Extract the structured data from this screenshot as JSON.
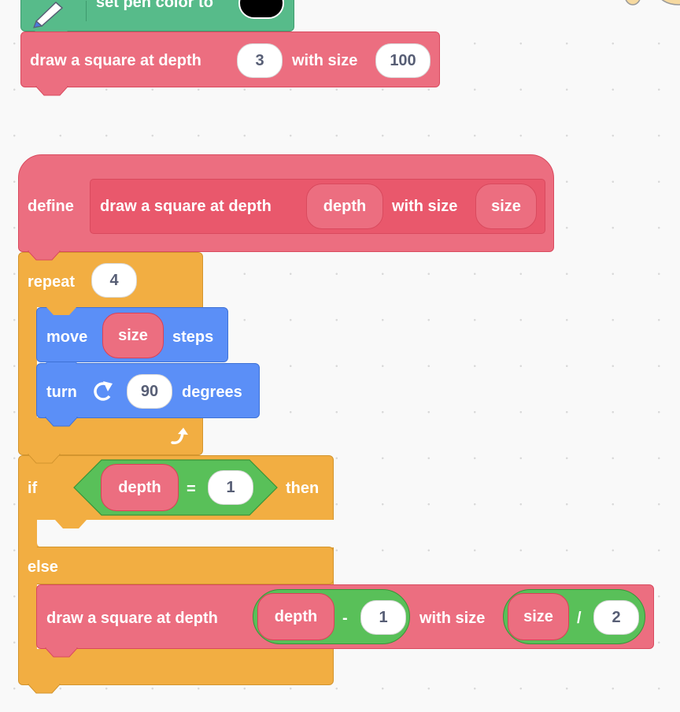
{
  "workspace": {
    "pen_block": {
      "label": "set pen color to",
      "color_value": "#000000",
      "icon": "pen-icon"
    },
    "call_block_top": {
      "label_1": "draw a square at depth",
      "depth_value": "3",
      "label_2": "with size",
      "size_value": "100"
    },
    "define_block": {
      "keyword": "define",
      "proto_label_1": "draw a square at depth",
      "param_1": "depth",
      "proto_label_2": "with size",
      "param_2": "size"
    },
    "repeat_block": {
      "keyword": "repeat",
      "count": "4",
      "loop_icon": "loop-arrow-icon"
    },
    "move_block": {
      "label_1": "move",
      "arg": "size",
      "label_2": "steps"
    },
    "turn_block": {
      "label_1": "turn",
      "icon": "rotate-right-icon",
      "value": "90",
      "label_2": "degrees"
    },
    "if_block": {
      "keyword_if": "if",
      "cond_left": "depth",
      "operator": "=",
      "cond_right": "1",
      "keyword_then": "then",
      "keyword_else": "else"
    },
    "call_block_inner": {
      "label_1": "draw a square at depth",
      "depth_left": "depth",
      "depth_op": "-",
      "depth_right": "1",
      "label_2": "with size",
      "size_left": "size",
      "size_op": "/",
      "size_right": "2"
    }
  },
  "colors": {
    "background": "#f9f9f9",
    "custom_block": "#ec6e80",
    "control": "#f2ae42",
    "motion": "#5b8ff7",
    "operators": "#59c059",
    "pen": "#57bb8a"
  }
}
